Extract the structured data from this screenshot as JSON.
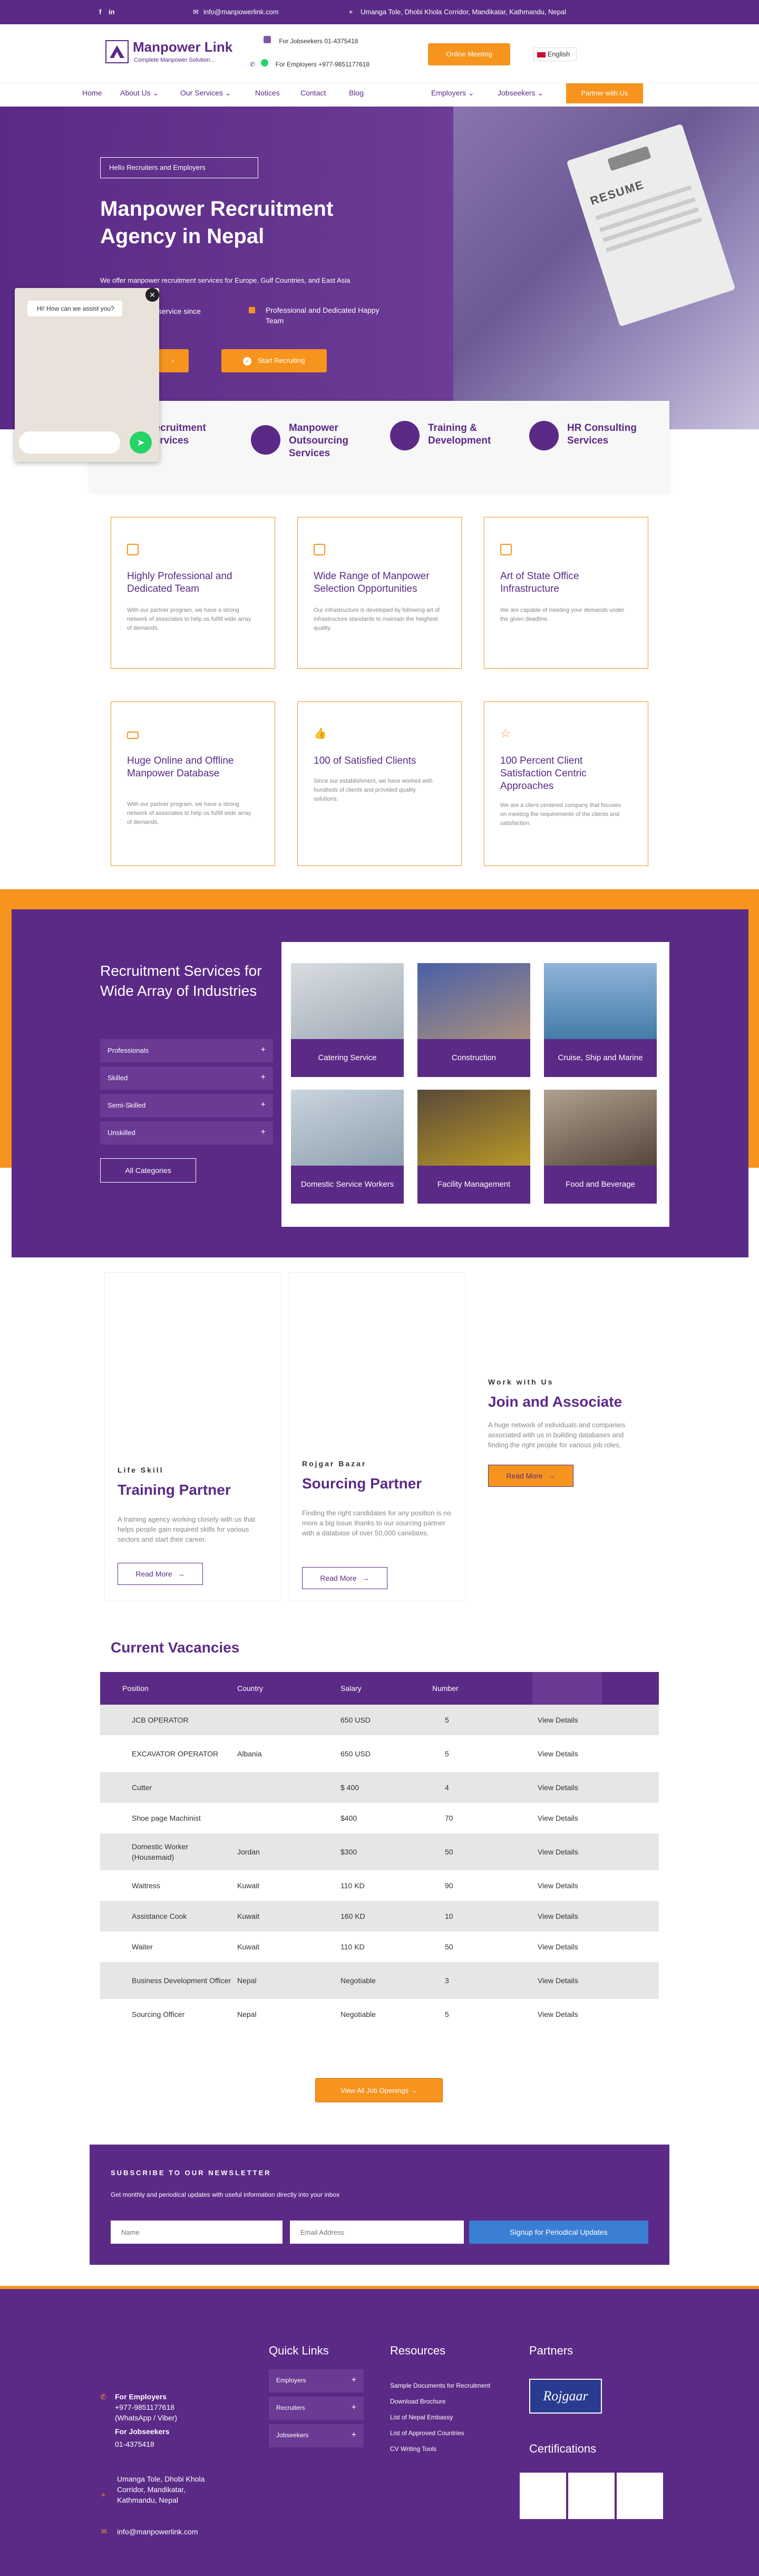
{
  "topbar": {
    "email": "info@manpowerlink.com",
    "address": "Umanga Tole, Dhobi Khola Corridor, Mandikatar, Kathmandu, Nepal",
    "facebook": "f",
    "linkedin": "in"
  },
  "header": {
    "brand": "Manpower Link",
    "tagline": "Complete Manpower Solution...",
    "jobseekers_phone": "For Jobseekers 01-4375418",
    "employers_phone": "For Employers +977-9851177618",
    "online_meeting": "Online Meeting",
    "language": "English"
  },
  "nav": {
    "home": "Home",
    "about": "About Us",
    "services": "Our Services",
    "notices": "Notices",
    "contact": "Contact",
    "blog": "Blog",
    "employers": "Employers",
    "jobseekers": "Jobseekers",
    "partner": "Partner with Us"
  },
  "hero": {
    "tag": "Hello Recruiters and Employers",
    "title": "Manpower Recruitment Agency in Nepal",
    "desc": "We offer manpower recruitment services for Europe, Gulf Countries, and East Asia",
    "feature1": "service since",
    "feature2": "Professional and Dedicated Happy Team",
    "start": "Start Recruiting",
    "clipboard": "RESUME"
  },
  "chat": {
    "bubble": "Hi! How can we assist you?"
  },
  "services": [
    {
      "label": "Recruitment Services"
    },
    {
      "label": "Manpower Outsourcing Services"
    },
    {
      "label": "Training & Development"
    },
    {
      "label": "HR Consulting Services"
    }
  ],
  "features": [
    {
      "title": "Highly Professional and Dedicated Team",
      "desc": "With our partner program, we have a strong network of associates to help us fulfill wide array of demands."
    },
    {
      "title": "Wide Range of Manpower Selection Opportunities",
      "desc": "Our infrastructure is developed by following art of infrastructure standards to maintain the heighest quality."
    },
    {
      "title": "Art of State Office Infrastructure",
      "desc": "We are capable of meeting your demands under the given deadline."
    },
    {
      "title": "Huge Online and Offline Manpower Database",
      "desc": "With our partner program, we have a strong network of associates to help us fulfill wide array of demands."
    },
    {
      "title": "100 of Satisfied Clients",
      "desc": "Since our establishment, we have worked with hundreds of clients and provided quality solutions."
    },
    {
      "title": "100 Percent Client Satisfaction Centric Approaches",
      "desc": "We are a client centered company that focuses on meeting the requirements of the clients and satisfaction."
    }
  ],
  "industries": {
    "title": "Recruitment Services for Wide Array of Industries",
    "levels": [
      "Professionals",
      "Skilled",
      "Semi-Skilled",
      "Unskilled"
    ],
    "all": "All Categories",
    "tiles": [
      "Catering Service",
      "Construction",
      "Cruise, Ship and Marine",
      "Domestic Service Workers",
      "Facility Management",
      "Food and Beverage"
    ]
  },
  "partners": [
    {
      "sub": "Life Skill",
      "title": "Training Partner",
      "desc": "A training agency working closely with us that helps people gain required skills for various sectors and start their career.",
      "btn": "Read More"
    },
    {
      "sub": "Rojgar Bazar",
      "title": "Sourcing Partner",
      "desc": "Finding the right candidates for any position is no more a big issue thanks to our sourcing partner with a database of over 50,000 canidates.",
      "btn": "Read More"
    },
    {
      "sub": "Work with Us",
      "title": "Join and Associate",
      "desc": "A huge network of individuals and companies associated with us in building databases and finding the right people for various job roles.",
      "btn": "Read More"
    }
  ],
  "vacancies": {
    "title": "Current Vacancies",
    "headers": [
      "Position",
      "Country",
      "Salary",
      "Number"
    ],
    "rows": [
      {
        "position": "JCB OPERATOR",
        "country": "",
        "salary": "650 USD",
        "number": "5",
        "link": "View Details"
      },
      {
        "position": "EXCAVATOR OPERATOR",
        "country": "Albania",
        "salary": "650 USD",
        "number": "5",
        "link": "View Details"
      },
      {
        "position": "Cutter",
        "country": "",
        "salary": "$ 400",
        "number": "4",
        "link": "View Details"
      },
      {
        "position": "Shoe page Machinist",
        "country": "",
        "salary": "$400",
        "number": "70",
        "link": "View Details"
      },
      {
        "position": "Domestic Worker (Housemaid)",
        "country": "Jordan",
        "salary": "$300",
        "number": "50",
        "link": "View Details"
      },
      {
        "position": "Waitress",
        "country": "Kuwait",
        "salary": "110 KD",
        "number": "90",
        "link": "View Details"
      },
      {
        "position": "Assistance Cook",
        "country": "Kuwait",
        "salary": "160 KD",
        "number": "10",
        "link": "View Details"
      },
      {
        "position": "Waiter",
        "country": "Kuwait",
        "salary": "110 KD",
        "number": "50",
        "link": "View Details"
      },
      {
        "position": "Business Development Officer",
        "country": "Nepal",
        "salary": "Negotiable",
        "number": "3",
        "link": "View Details"
      },
      {
        "position": "Sourcing Officer",
        "country": "Nepal",
        "salary": "Negotiable",
        "number": "5",
        "link": "View Details"
      }
    ],
    "all_btn": "View All Job Openings"
  },
  "newsletter": {
    "title": "SUBSCRIBE TO OUR NEWSLETTER",
    "desc": "Get monthly and periodical updates with useful information directly into your inbox",
    "name_ph": "Name",
    "email_ph": "Email Address",
    "btn": "Signup for Periodical Updates"
  },
  "footer": {
    "employers_label": "For Employers",
    "employers_phone": "+977-9851177618",
    "employers_note": "(WhatsApp / Viber)",
    "jobseekers_label": "For Jobseekers",
    "jobseekers_phone": "01-4375418",
    "address": "Umanga Tole, Dhobi Khola Corridor, Mandikatar, Kathmandu, Nepal",
    "email": "info@manpowerlink.com",
    "quick_title": "Quick Links",
    "quick": [
      "Employers",
      "Recruiters",
      "Jobseekers"
    ],
    "resources_title": "Resources",
    "resources": [
      "Sample Documents for Recruitment",
      "Download Brochure",
      "List of Nepal Embassy",
      "List of Approved Countries",
      "CV Writing Tools"
    ],
    "partners_title": "Partners",
    "partner_logo": "Rojgaar",
    "cert_title": "Certifications"
  }
}
